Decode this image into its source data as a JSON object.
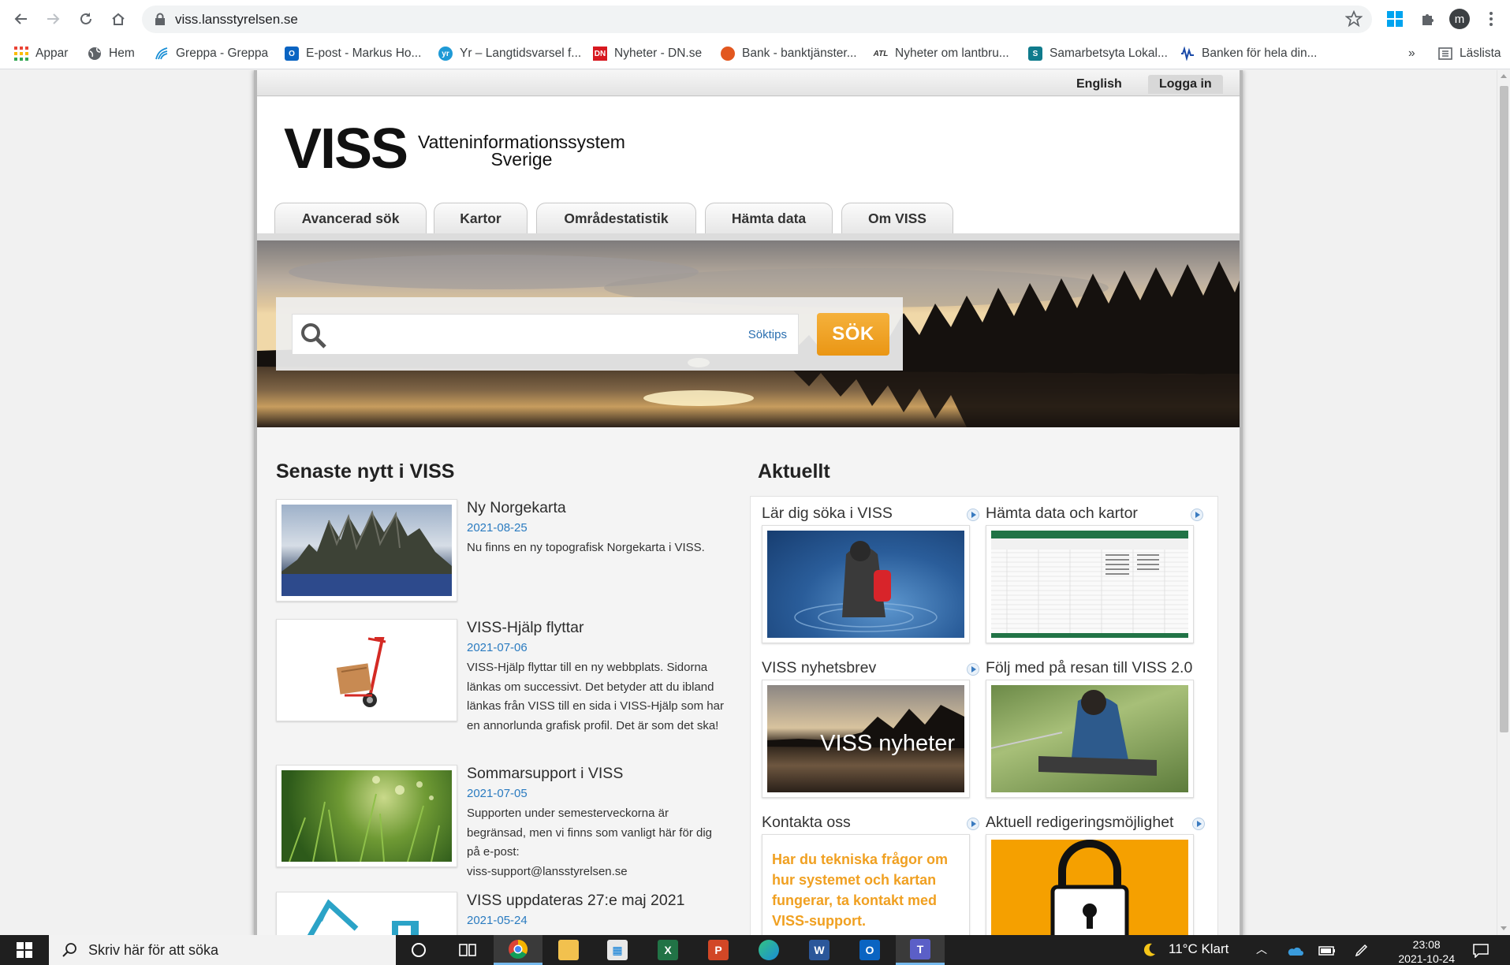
{
  "browser": {
    "url": "viss.lansstyrelsen.se",
    "bookmarks": [
      {
        "label": "Appar",
        "icon": "apps-grid-icon",
        "color": "#ea4335"
      },
      {
        "label": "Hem",
        "icon": "globe-icon",
        "color": "#5f6368"
      },
      {
        "label": "Greppa - Greppa",
        "icon": "greppa-icon",
        "color": "#1a8fd6"
      },
      {
        "label": "E-post - Markus Ho...",
        "icon": "outlook-icon",
        "color": "#0a64c2"
      },
      {
        "label": "Yr – Langtidsvarsel f...",
        "icon": "yr-icon",
        "color": "#1f9ad6"
      },
      {
        "label": "Nyheter - DN.se",
        "icon": "dn-icon",
        "color": "#d71920"
      },
      {
        "label": "Bank - banktjänster...",
        "icon": "bank-icon",
        "color": "#e2571f"
      },
      {
        "label": "Nyheter om lantbru...",
        "icon": "atl-icon",
        "color": "#333333"
      },
      {
        "label": "Samarbetsyta Lokal...",
        "icon": "sharepoint-icon",
        "color": "#0f7b8c"
      },
      {
        "label": "Banken för hela din...",
        "icon": "wave-icon",
        "color": "#1a4aa8"
      }
    ],
    "more_label": "»",
    "reading_list": "Läslista",
    "profile_initial": "m"
  },
  "site": {
    "lang_link": "English",
    "login_link": "Logga in",
    "logo_main": "VISS",
    "logo_line1": "Vatteninformationssystem",
    "logo_line2": "Sverige",
    "tabs": [
      "Avancerad sök",
      "Kartor",
      "Områdestatistik",
      "Hämta data",
      "Om VISS"
    ],
    "search": {
      "placeholder": "",
      "tips": "Söktips",
      "button": "SÖK"
    },
    "news_heading": "Senaste nytt i VISS",
    "news": [
      {
        "title": "Ny Norgekarta",
        "date": "2021-08-25",
        "text": "Nu finns en ny topografisk Norgekarta i VISS."
      },
      {
        "title": "VISS-Hjälp flyttar",
        "date": "2021-07-06",
        "text": "VISS-Hjälp flyttar till en ny webbplats. Sidorna länkas om successivt. Det betyder att du ibland länkas från VISS till en sida i VISS-Hjälp som har en annorlunda grafisk profil. Det är som det ska!"
      },
      {
        "title": "Sommarsupport i VISS",
        "date": "2021-07-05",
        "text": "Supporten under semesterveckorna är begränsad, men vi finns som vanligt här för dig på e-post:",
        "email": "viss-support@lansstyrelsen.se"
      },
      {
        "title": "VISS uppdateras 27:e maj 2021",
        "date": "2021-05-24",
        "text": ""
      }
    ],
    "current_heading": "Aktuellt",
    "cards": [
      {
        "title": "Lär dig söka i VISS"
      },
      {
        "title": "Hämta data och kartor"
      },
      {
        "title": "VISS nyhetsbrev",
        "overlay": "VISS nyheter"
      },
      {
        "title": "Följ med på resan till VISS 2.0"
      },
      {
        "title": "Kontakta oss",
        "overlay": "Har du tekniska frågor om hur systemet och kartan fungerar, ta kontakt med VISS-support."
      },
      {
        "title": "Aktuell redigeringsmöjlighet"
      }
    ]
  },
  "taskbar": {
    "search_placeholder": "Skriv här för att söka",
    "weather": "11°C  Klart",
    "time": "23:08",
    "date": "2021-10-24"
  },
  "colors": {
    "accent_orange": "#f0a021",
    "link_blue": "#2a7bc0"
  }
}
